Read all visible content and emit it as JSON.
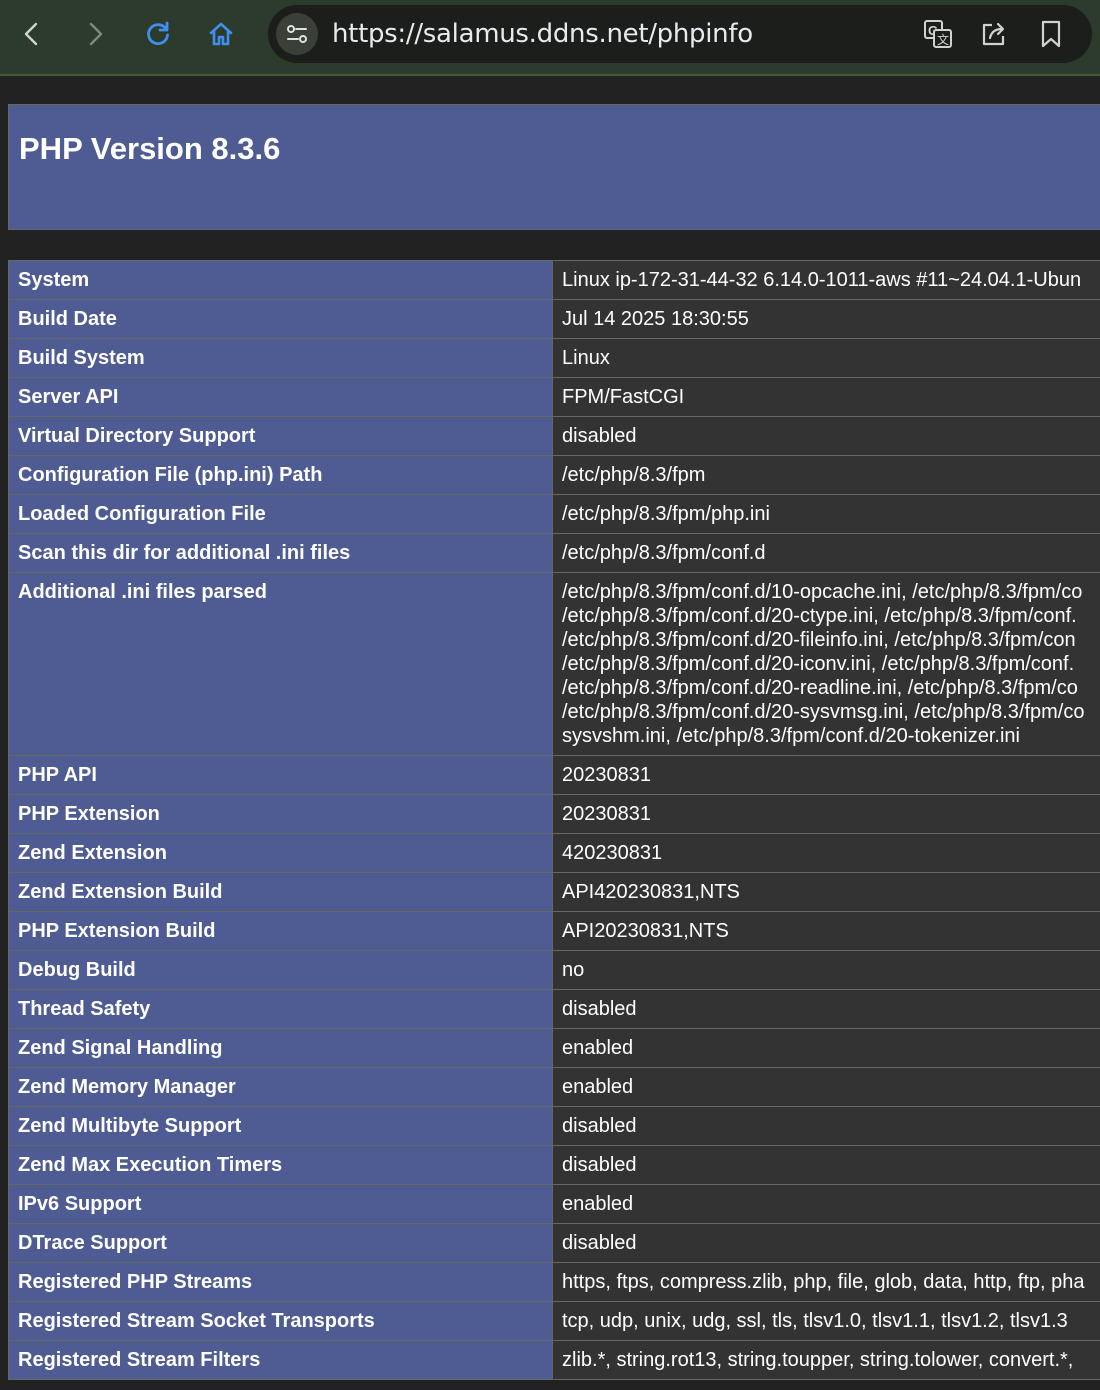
{
  "browser": {
    "url": "https://salamus.ddns.net/phpinfo"
  },
  "page": {
    "title": "PHP Version 8.3.6"
  },
  "rows": [
    {
      "label": "System",
      "value": "Linux ip-172-31-44-32 6.14.0-1011-aws #11~24.04.1-Ubun"
    },
    {
      "label": "Build Date",
      "value": "Jul 14 2025 18:30:55"
    },
    {
      "label": "Build System",
      "value": "Linux"
    },
    {
      "label": "Server API",
      "value": "FPM/FastCGI"
    },
    {
      "label": "Virtual Directory Support",
      "value": "disabled"
    },
    {
      "label": "Configuration File (php.ini) Path",
      "value": "/etc/php/8.3/fpm"
    },
    {
      "label": "Loaded Configuration File",
      "value": "/etc/php/8.3/fpm/php.ini"
    },
    {
      "label": "Scan this dir for additional .ini files",
      "value": "/etc/php/8.3/fpm/conf.d"
    },
    {
      "label": "Additional .ini files parsed",
      "lines": [
        "/etc/php/8.3/fpm/conf.d/10-opcache.ini, /etc/php/8.3/fpm/co",
        "/etc/php/8.3/fpm/conf.d/20-ctype.ini, /etc/php/8.3/fpm/conf.",
        "/etc/php/8.3/fpm/conf.d/20-fileinfo.ini, /etc/php/8.3/fpm/con",
        "/etc/php/8.3/fpm/conf.d/20-iconv.ini, /etc/php/8.3/fpm/conf.",
        "/etc/php/8.3/fpm/conf.d/20-readline.ini, /etc/php/8.3/fpm/co",
        "/etc/php/8.3/fpm/conf.d/20-sysvmsg.ini, /etc/php/8.3/fpm/co",
        "sysvshm.ini, /etc/php/8.3/fpm/conf.d/20-tokenizer.ini"
      ]
    },
    {
      "label": "PHP API",
      "value": "20230831"
    },
    {
      "label": "PHP Extension",
      "value": "20230831"
    },
    {
      "label": "Zend Extension",
      "value": "420230831"
    },
    {
      "label": "Zend Extension Build",
      "value": "API420230831,NTS"
    },
    {
      "label": "PHP Extension Build",
      "value": "API20230831,NTS"
    },
    {
      "label": "Debug Build",
      "value": "no"
    },
    {
      "label": "Thread Safety",
      "value": "disabled"
    },
    {
      "label": "Zend Signal Handling",
      "value": "enabled"
    },
    {
      "label": "Zend Memory Manager",
      "value": "enabled"
    },
    {
      "label": "Zend Multibyte Support",
      "value": "disabled"
    },
    {
      "label": "Zend Max Execution Timers",
      "value": "disabled"
    },
    {
      "label": "IPv6 Support",
      "value": "enabled"
    },
    {
      "label": "DTrace Support",
      "value": "disabled"
    },
    {
      "label": "Registered PHP Streams",
      "value": "https, ftps, compress.zlib, php, file, glob, data, http, ftp, pha"
    },
    {
      "label": "Registered Stream Socket Transports",
      "value": "tcp, udp, unix, udg, ssl, tls, tlsv1.0, tlsv1.1, tlsv1.2, tlsv1.3"
    },
    {
      "label": "Registered Stream Filters",
      "value": "zlib.*, string.rot13, string.toupper, string.tolower, convert.*,"
    }
  ]
}
